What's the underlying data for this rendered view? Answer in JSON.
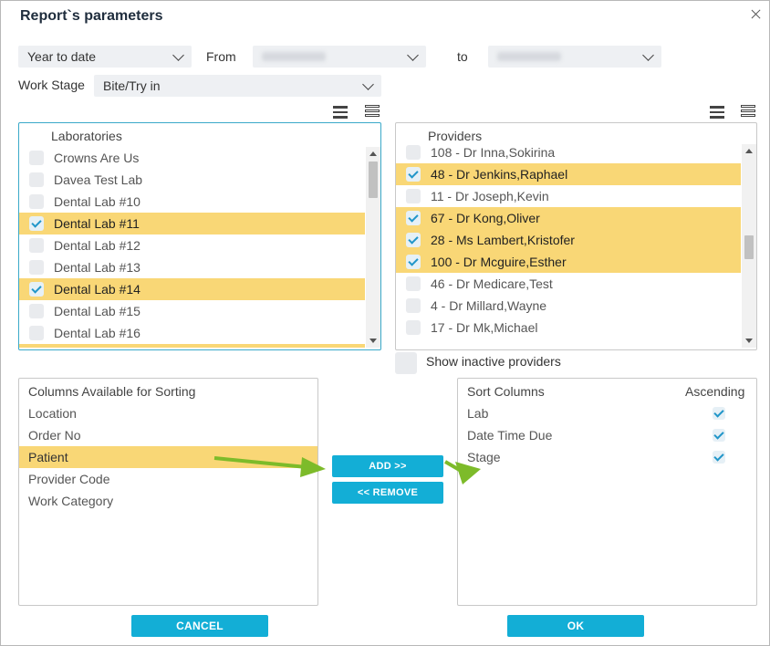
{
  "dialog": {
    "title": "Report`s parameters",
    "close_icon": "close-icon"
  },
  "filters": {
    "period": "Year to date",
    "from_label": "From",
    "to_label": "to",
    "work_stage_label": "Work Stage",
    "work_stage_value": "Bite/Try in"
  },
  "laboratories": {
    "header": "Laboratories",
    "items": [
      {
        "label": "Crowns Are Us",
        "checked": false
      },
      {
        "label": "Davea Test Lab",
        "checked": false
      },
      {
        "label": "Dental Lab #10",
        "checked": false
      },
      {
        "label": "Dental Lab #11",
        "checked": true
      },
      {
        "label": "Dental Lab #12",
        "checked": false
      },
      {
        "label": "Dental Lab #13",
        "checked": false
      },
      {
        "label": "Dental Lab #14",
        "checked": true
      },
      {
        "label": "Dental Lab #15",
        "checked": false
      },
      {
        "label": "Dental Lab #16",
        "checked": false
      }
    ]
  },
  "providers": {
    "header": "Providers",
    "items": [
      {
        "label": "108 - Dr Inna,Sokirina",
        "checked": false
      },
      {
        "label": "48 - Dr Jenkins,Raphael",
        "checked": true
      },
      {
        "label": "11 - Dr Joseph,Kevin",
        "checked": false
      },
      {
        "label": "67 - Dr Kong,Oliver",
        "checked": true
      },
      {
        "label": "28 - Ms Lambert,Kristofer",
        "checked": true
      },
      {
        "label": "100 - Dr Mcguire,Esther",
        "checked": true
      },
      {
        "label": "46 - Dr Medicare,Test",
        "checked": false
      },
      {
        "label": "4 - Dr Millard,Wayne",
        "checked": false
      },
      {
        "label": "17 - Dr Mk,Michael",
        "checked": false
      }
    ],
    "show_inactive_label": "Show inactive providers"
  },
  "available_columns": {
    "header": "Columns Available for Sorting",
    "items": [
      "Location",
      "Order No",
      "Patient",
      "Provider Code",
      "Work Category"
    ],
    "selected": "Patient"
  },
  "sort_columns": {
    "header": "Sort Columns",
    "ascending_header": "Ascending",
    "items": [
      {
        "label": "Lab",
        "ascending": true
      },
      {
        "label": "Date Time Due",
        "ascending": true
      },
      {
        "label": "Stage",
        "ascending": true
      }
    ]
  },
  "buttons": {
    "add": "ADD >>",
    "remove": "<< REMOVE",
    "cancel": "CANCEL",
    "ok": "OK"
  },
  "colors": {
    "accent": "#13aed6",
    "selection": "#f9d776",
    "arrow": "#7dbb2a"
  }
}
